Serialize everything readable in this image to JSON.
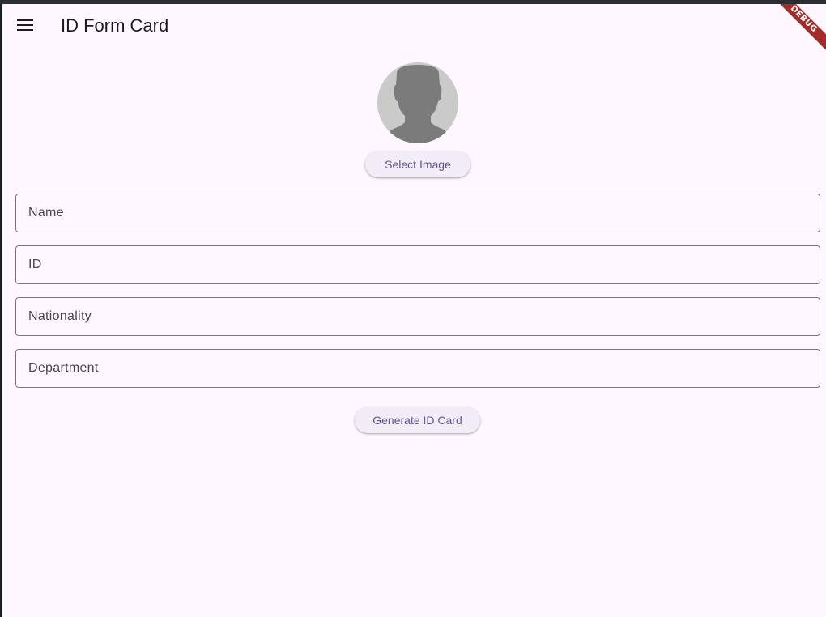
{
  "app": {
    "title": "ID Form Card",
    "debug_banner": "DEBUG"
  },
  "avatar": {
    "icon": "person-silhouette-icon"
  },
  "select_image_button": "Select Image",
  "fields": [
    {
      "label": "Name"
    },
    {
      "label": "ID"
    },
    {
      "label": "Nationality"
    },
    {
      "label": "Department"
    }
  ],
  "generate_button": "Generate ID Card",
  "colors": {
    "background": "#fef7ff",
    "button_bg": "#f3edf7",
    "button_text": "#65558f",
    "outline": "#79747e",
    "label": "#49454f",
    "avatar_bg": "#cacaca",
    "silhouette": "#7b7b7b",
    "debug_banner": "#a52a2a"
  }
}
